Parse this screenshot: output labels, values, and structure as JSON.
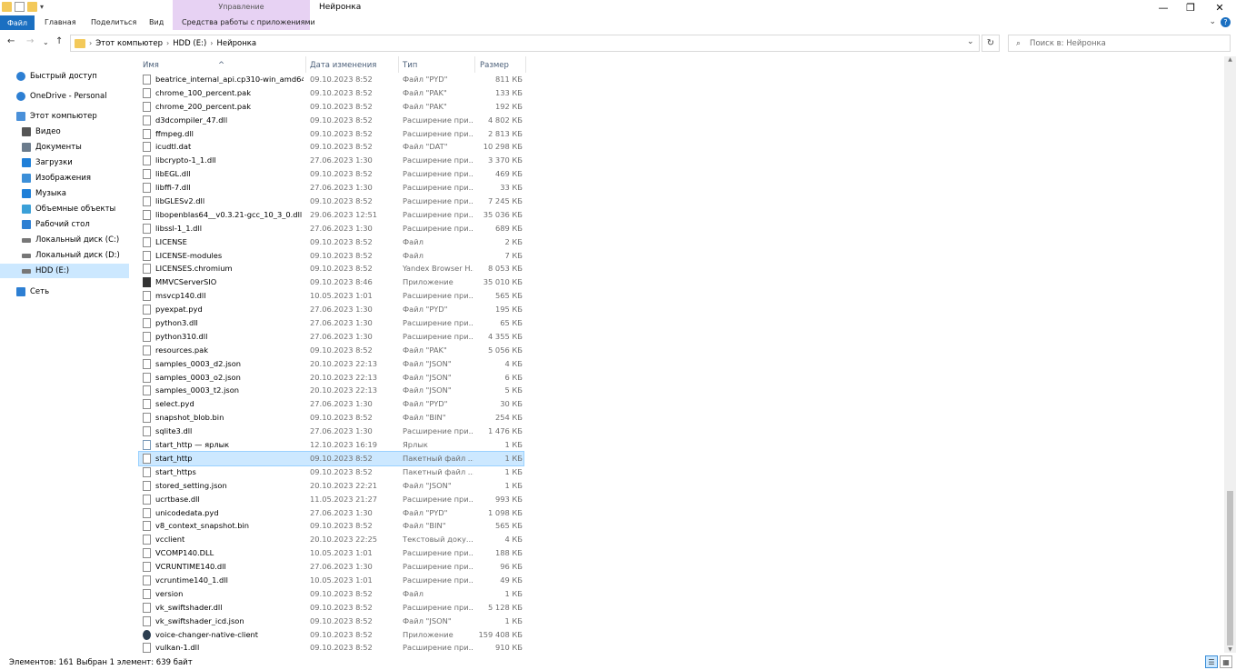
{
  "window": {
    "title": "Нейронка",
    "manage_tab": "Управление",
    "minimize": "—",
    "maximize": "❐",
    "close": "✕"
  },
  "ribbon": {
    "file": "Файл",
    "home": "Главная",
    "share": "Поделиться",
    "view": "Вид",
    "app_tools": "Средства работы с приложениями",
    "expand": "⌄",
    "help": "?"
  },
  "address": {
    "crumbs": [
      "Этот компьютер",
      "HDD (E:)",
      "Нейронка"
    ],
    "separator": "›",
    "dropdown": "⌄",
    "refresh": "↻"
  },
  "search": {
    "placeholder": "Поиск в: Нейронка",
    "icon": "magnifier-icon"
  },
  "nav": {
    "back": "←",
    "forward": "→",
    "recent": "⌄",
    "up": "↑",
    "items": [
      {
        "label": "Быстрый доступ",
        "icon": "star-icon",
        "color": "#2d7fd3"
      },
      {
        "label": "OneDrive - Personal",
        "icon": "cloud-icon",
        "color": "#2d7fd3"
      },
      {
        "label": "Этот компьютер",
        "icon": "computer-icon",
        "color": "#4a90d9"
      },
      {
        "label": "Видео",
        "icon": "video-icon",
        "color": "#555"
      },
      {
        "label": "Документы",
        "icon": "documents-icon",
        "color": "#6b7b8c"
      },
      {
        "label": "Загрузки",
        "icon": "download-icon",
        "color": "#1f7fd8"
      },
      {
        "label": "Изображения",
        "icon": "pictures-icon",
        "color": "#3c8fd8"
      },
      {
        "label": "Музыка",
        "icon": "music-icon",
        "color": "#1f7fd8"
      },
      {
        "label": "Объемные объекты",
        "icon": "3d-objects-icon",
        "color": "#3ba0d8"
      },
      {
        "label": "Рабочий стол",
        "icon": "desktop-icon",
        "color": "#2d7fd3"
      },
      {
        "label": "Локальный диск (C:)",
        "icon": "disk-icon",
        "color": "#777"
      },
      {
        "label": "Локальный диск (D:)",
        "icon": "disk-icon",
        "color": "#777"
      },
      {
        "label": "HDD (E:)",
        "icon": "disk-icon",
        "color": "#777"
      },
      {
        "label": "Сеть",
        "icon": "network-icon",
        "color": "#2d7fd3"
      }
    ]
  },
  "columns": {
    "name": "Имя",
    "date": "Дата изменения",
    "type": "Тип",
    "size": "Размер",
    "sort": "^"
  },
  "files": [
    {
      "name": "beatrice_internal_api.cp310-win_amd64.pyd",
      "date": "09.10.2023 8:52",
      "type": "Файл \"PYD\"",
      "size": "811 КБ"
    },
    {
      "name": "chrome_100_percent.pak",
      "date": "09.10.2023 8:52",
      "type": "Файл \"PAK\"",
      "size": "133 КБ"
    },
    {
      "name": "chrome_200_percent.pak",
      "date": "09.10.2023 8:52",
      "type": "Файл \"PAK\"",
      "size": "192 КБ"
    },
    {
      "name": "d3dcompiler_47.dll",
      "date": "09.10.2023 8:52",
      "type": "Расширение при...",
      "size": "4 802 КБ"
    },
    {
      "name": "ffmpeg.dll",
      "date": "09.10.2023 8:52",
      "type": "Расширение при...",
      "size": "2 813 КБ"
    },
    {
      "name": "icudtl.dat",
      "date": "09.10.2023 8:52",
      "type": "Файл \"DAT\"",
      "size": "10 298 КБ"
    },
    {
      "name": "libcrypto-1_1.dll",
      "date": "27.06.2023 1:30",
      "type": "Расширение при...",
      "size": "3 370 КБ"
    },
    {
      "name": "libEGL.dll",
      "date": "09.10.2023 8:52",
      "type": "Расширение при...",
      "size": "469 КБ"
    },
    {
      "name": "libffi-7.dll",
      "date": "27.06.2023 1:30",
      "type": "Расширение при...",
      "size": "33 КБ"
    },
    {
      "name": "libGLESv2.dll",
      "date": "09.10.2023 8:52",
      "type": "Расширение при...",
      "size": "7 245 КБ"
    },
    {
      "name": "libopenblas64__v0.3.21-gcc_10_3_0.dll",
      "date": "29.06.2023 12:51",
      "type": "Расширение при...",
      "size": "35 036 КБ"
    },
    {
      "name": "libssl-1_1.dll",
      "date": "27.06.2023 1:30",
      "type": "Расширение при...",
      "size": "689 КБ"
    },
    {
      "name": "LICENSE",
      "date": "09.10.2023 8:52",
      "type": "Файл",
      "size": "2 КБ"
    },
    {
      "name": "LICENSE-modules",
      "date": "09.10.2023 8:52",
      "type": "Файл",
      "size": "7 КБ"
    },
    {
      "name": "LICENSES.chromium",
      "date": "09.10.2023 8:52",
      "type": "Yandex Browser H...",
      "size": "8 053 КБ"
    },
    {
      "name": "MMVCServerSIO",
      "date": "09.10.2023 8:46",
      "type": "Приложение",
      "size": "35 010 КБ",
      "kind": "app"
    },
    {
      "name": "msvcp140.dll",
      "date": "10.05.2023 1:01",
      "type": "Расширение при...",
      "size": "565 КБ"
    },
    {
      "name": "pyexpat.pyd",
      "date": "27.06.2023 1:30",
      "type": "Файл \"PYD\"",
      "size": "195 КБ"
    },
    {
      "name": "python3.dll",
      "date": "27.06.2023 1:30",
      "type": "Расширение при...",
      "size": "65 КБ"
    },
    {
      "name": "python310.dll",
      "date": "27.06.2023 1:30",
      "type": "Расширение при...",
      "size": "4 355 КБ"
    },
    {
      "name": "resources.pak",
      "date": "09.10.2023 8:52",
      "type": "Файл \"PAK\"",
      "size": "5 056 КБ"
    },
    {
      "name": "samples_0003_d2.json",
      "date": "20.10.2023 22:13",
      "type": "Файл \"JSON\"",
      "size": "4 КБ"
    },
    {
      "name": "samples_0003_o2.json",
      "date": "20.10.2023 22:13",
      "type": "Файл \"JSON\"",
      "size": "6 КБ"
    },
    {
      "name": "samples_0003_t2.json",
      "date": "20.10.2023 22:13",
      "type": "Файл \"JSON\"",
      "size": "5 КБ"
    },
    {
      "name": "select.pyd",
      "date": "27.06.2023 1:30",
      "type": "Файл \"PYD\"",
      "size": "30 КБ"
    },
    {
      "name": "snapshot_blob.bin",
      "date": "09.10.2023 8:52",
      "type": "Файл \"BIN\"",
      "size": "254 КБ"
    },
    {
      "name": "sqlite3.dll",
      "date": "27.06.2023 1:30",
      "type": "Расширение при...",
      "size": "1 476 КБ"
    },
    {
      "name": "start_http — ярлык",
      "date": "12.10.2023 16:19",
      "type": "Ярлык",
      "size": "1 КБ",
      "kind": "link"
    },
    {
      "name": "start_http",
      "date": "09.10.2023 8:52",
      "type": "Пакетный файл ...",
      "size": "1 КБ",
      "selected": true
    },
    {
      "name": "start_https",
      "date": "09.10.2023 8:52",
      "type": "Пакетный файл ...",
      "size": "1 КБ"
    },
    {
      "name": "stored_setting.json",
      "date": "20.10.2023 22:21",
      "type": "Файл \"JSON\"",
      "size": "1 КБ"
    },
    {
      "name": "ucrtbase.dll",
      "date": "11.05.2023 21:27",
      "type": "Расширение при...",
      "size": "993 КБ"
    },
    {
      "name": "unicodedata.pyd",
      "date": "27.06.2023 1:30",
      "type": "Файл \"PYD\"",
      "size": "1 098 КБ"
    },
    {
      "name": "v8_context_snapshot.bin",
      "date": "09.10.2023 8:52",
      "type": "Файл \"BIN\"",
      "size": "565 КБ"
    },
    {
      "name": "vcclient",
      "date": "20.10.2023 22:25",
      "type": "Текстовый доку...",
      "size": "4 КБ"
    },
    {
      "name": "VCOMP140.DLL",
      "date": "10.05.2023 1:01",
      "type": "Расширение при...",
      "size": "188 КБ"
    },
    {
      "name": "VCRUNTIME140.dll",
      "date": "27.06.2023 1:30",
      "type": "Расширение при...",
      "size": "96 КБ"
    },
    {
      "name": "vcruntime140_1.dll",
      "date": "10.05.2023 1:01",
      "type": "Расширение при...",
      "size": "49 КБ"
    },
    {
      "name": "version",
      "date": "09.10.2023 8:52",
      "type": "Файл",
      "size": "1 КБ"
    },
    {
      "name": "vk_swiftshader.dll",
      "date": "09.10.2023 8:52",
      "type": "Расширение при...",
      "size": "5 128 КБ"
    },
    {
      "name": "vk_swiftshader_icd.json",
      "date": "09.10.2023 8:52",
      "type": "Файл \"JSON\"",
      "size": "1 КБ"
    },
    {
      "name": "voice-changer-native-client",
      "date": "09.10.2023 8:52",
      "type": "Приложение",
      "size": "159 408 КБ",
      "kind": "app2"
    },
    {
      "name": "vulkan-1.dll",
      "date": "09.10.2023 8:52",
      "type": "Расширение при...",
      "size": "910 КБ"
    }
  ],
  "status": {
    "count": "Элементов: 161",
    "selected": "Выбран 1 элемент: 639 байт",
    "details_view": "☰",
    "tiles_view": "▦"
  },
  "scroll": {
    "up": "▲",
    "down": "▼"
  },
  "colors": {
    "accent": "#1a6fc1",
    "manage_tab": "#e7d2f3",
    "selection": "#cce8ff"
  }
}
